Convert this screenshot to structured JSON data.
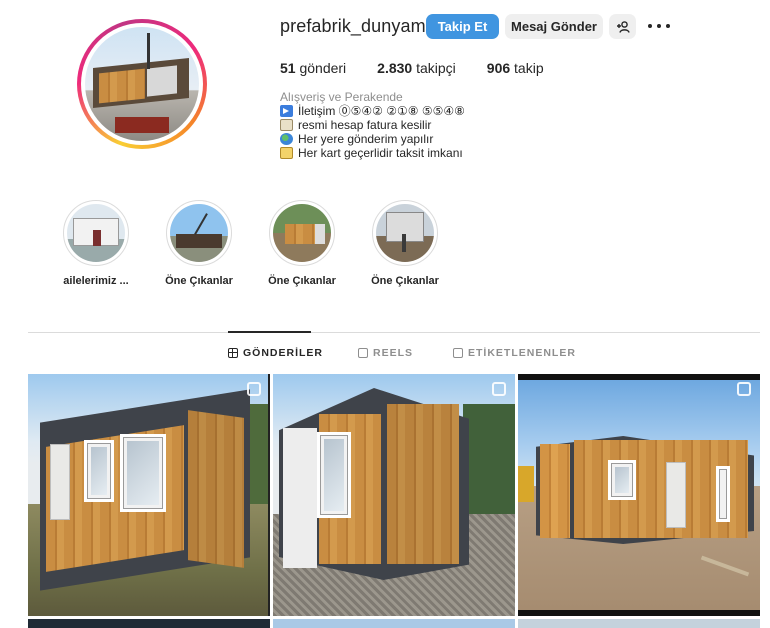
{
  "profile": {
    "username": "prefabrik_dunyam",
    "follow_label": "Takip Et",
    "message_label": "Mesaj Gönder",
    "posts_count": "51",
    "posts_label": " gönderi",
    "followers_count": "2.830",
    "followers_label": " takipçi",
    "following_count": "906",
    "following_label": " takip"
  },
  "bio": {
    "category": "Alışveriş ve Perakende",
    "lines": [
      {
        "icon": "arrow-right-icon",
        "text": "İletişim ⓪⑤④② ②①⑧ ⑤⑤④⑧"
      },
      {
        "icon": "book-icon",
        "text": "resmi hesap fatura kesilir"
      },
      {
        "icon": "globe-icon",
        "text": "Her yere gönderim yapılır"
      },
      {
        "icon": "credit-card-icon",
        "text": "Her kart geçerlidir taksit imkanı"
      }
    ]
  },
  "highlights": [
    {
      "label": "ailelerimiz ..."
    },
    {
      "label": "Öne Çıkanlar"
    },
    {
      "label": "Öne Çıkanlar"
    },
    {
      "label": "Öne Çıkanlar"
    }
  ],
  "tabs": {
    "posts": "GÖNDERİLER",
    "reels": "REELS",
    "tagged": "ETİKETLENENLER"
  },
  "colors": {
    "follow_button": "#4095e0",
    "secondary_button": "#efefef",
    "text": "#262626",
    "muted": "#8e8e8e"
  }
}
